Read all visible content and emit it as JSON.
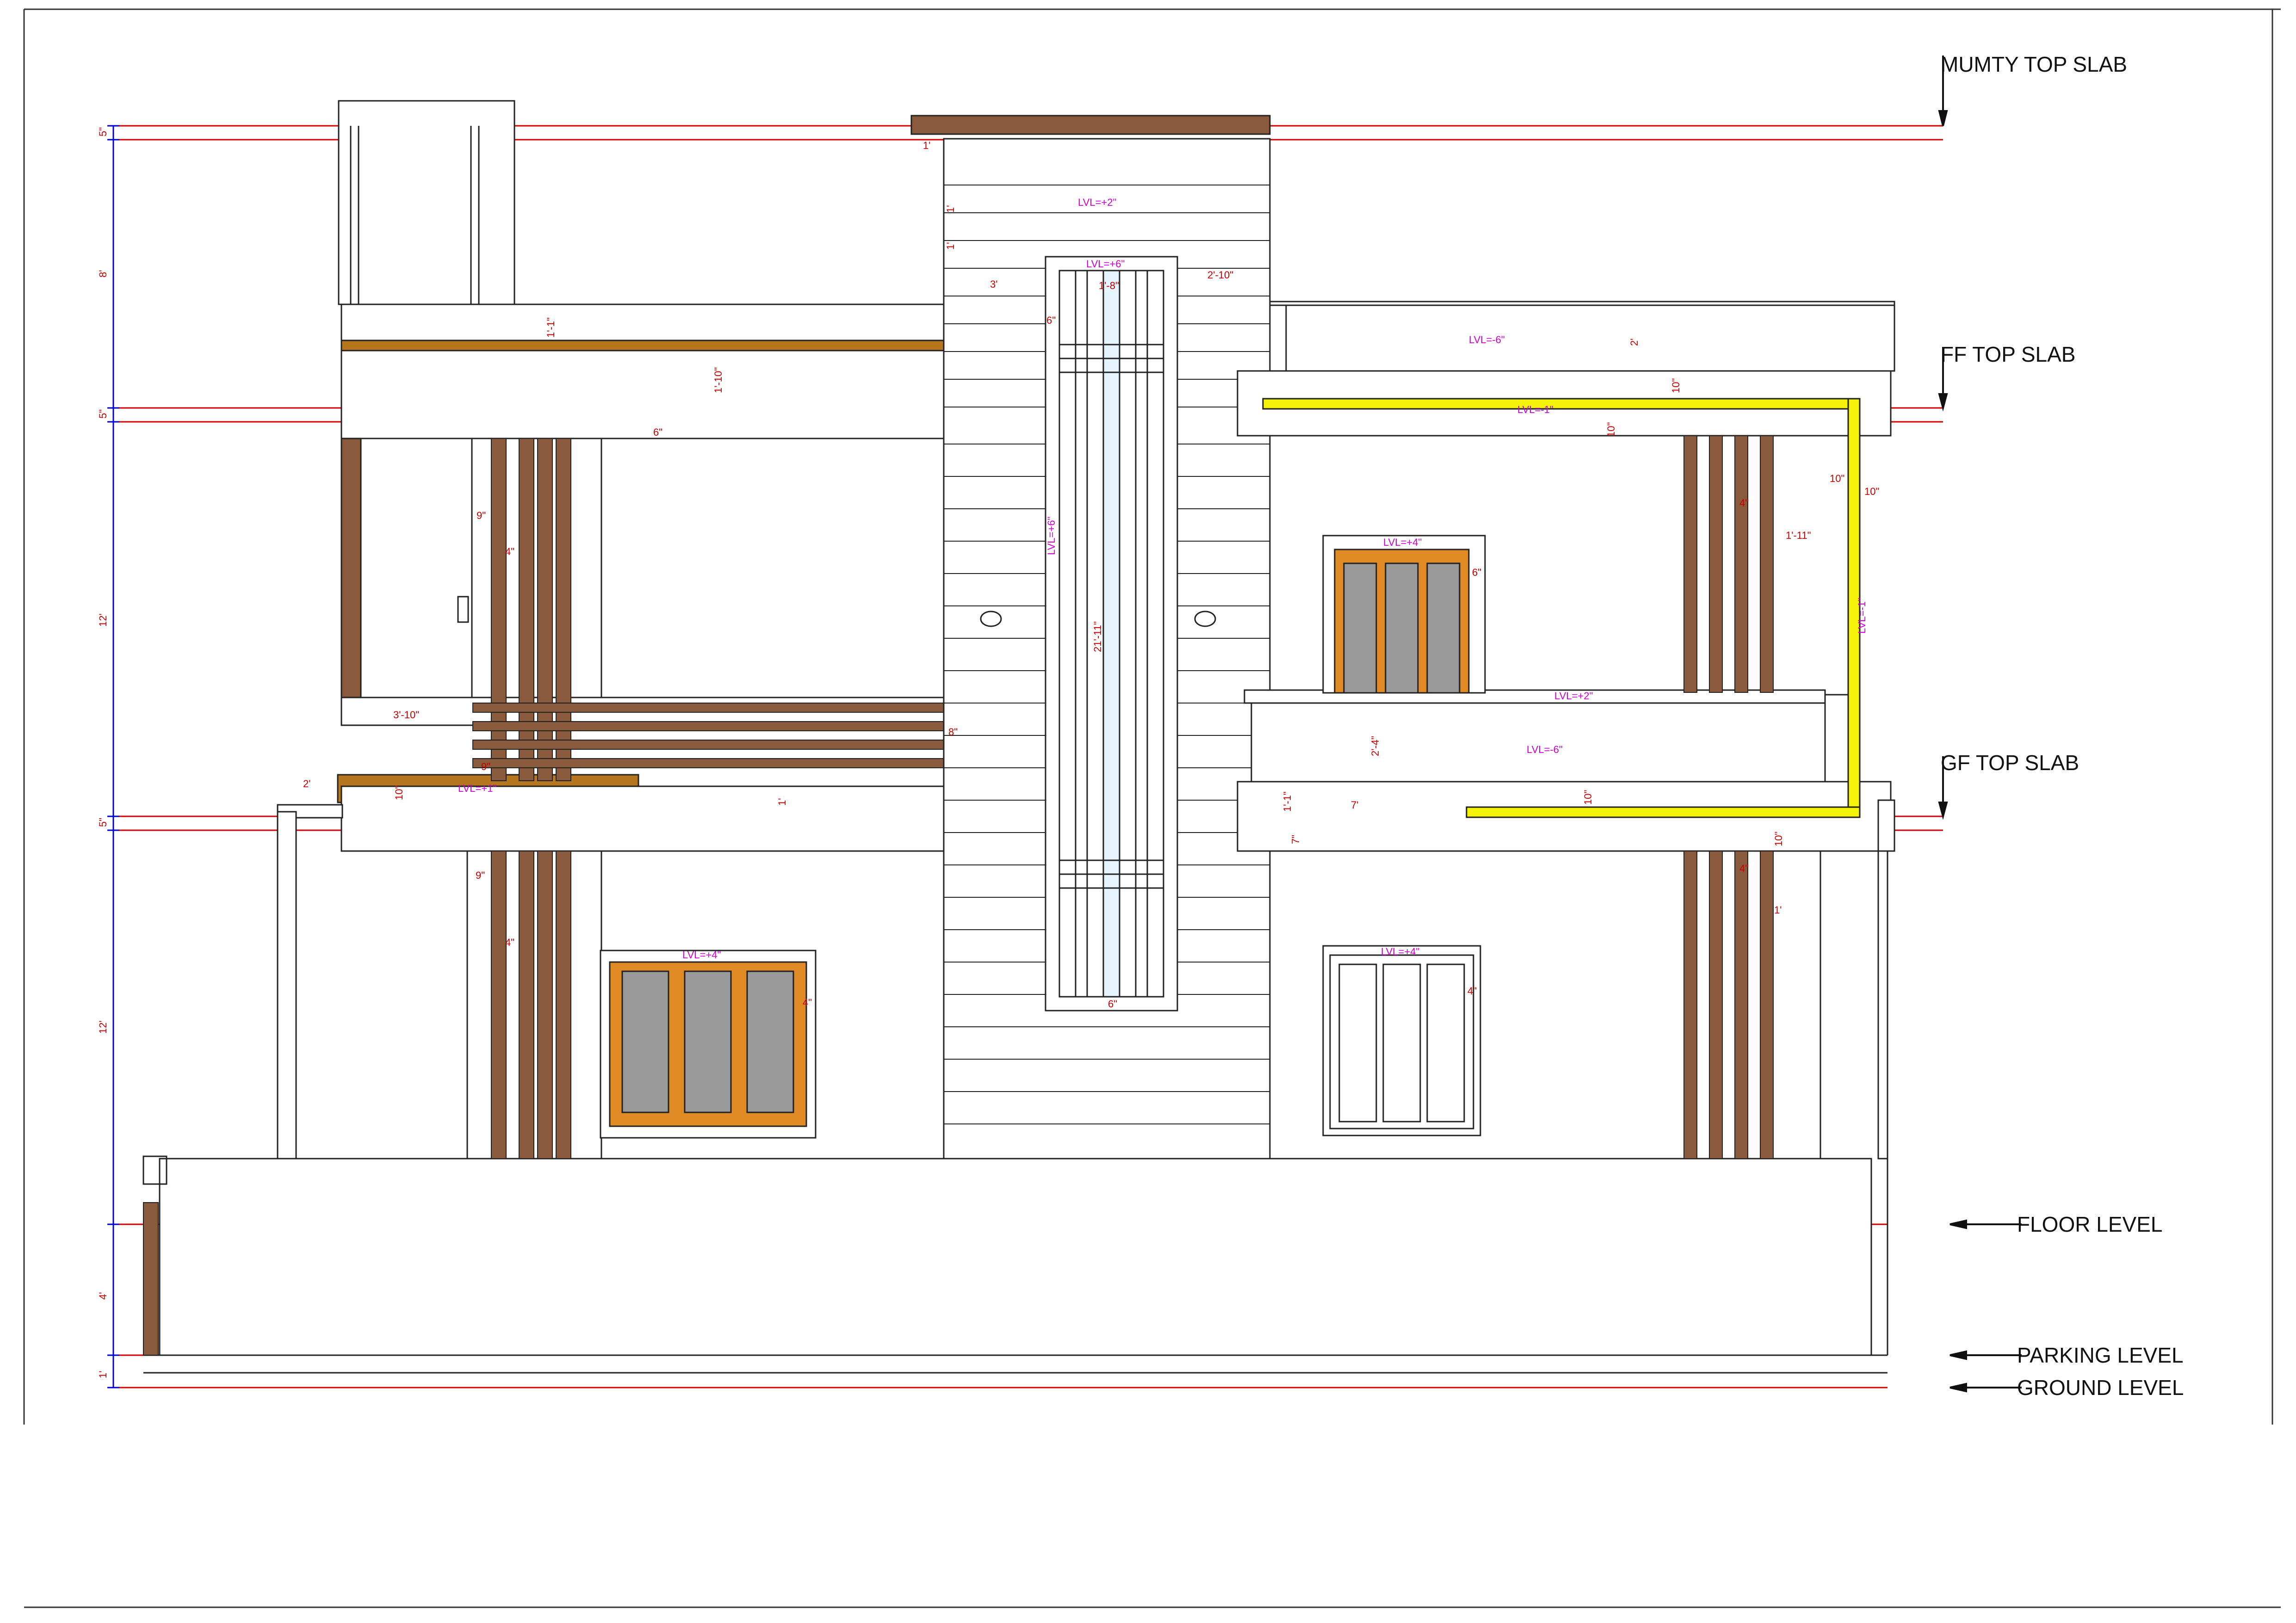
{
  "levels": {
    "mumty_top_slab": "MUMTY TOP SLAB",
    "ff_top_slab": "FF TOP SLAB",
    "gf_top_slab": "GF TOP SLAB",
    "floor_level": "FLOOR LEVEL",
    "parking_level": "PARKING LEVEL",
    "ground_level": "GROUND LEVEL"
  },
  "vertical_dims": {
    "mumty_slab": "5\"",
    "mumty_height": "8'",
    "ff_slab": "5\"",
    "ff_height": "12'",
    "gf_slab": "5\"",
    "gf_height": "12'",
    "plinth": "4'",
    "parking": "1'"
  },
  "dims": {
    "d_1ft": "1'",
    "d_3ft": "3'",
    "d_2ft10": "2'-10\"",
    "d_1ft8": "1'-8\"",
    "d_6in": "6\"",
    "d_4in": "4\"",
    "d_9in": "9\"",
    "d_3ft10": "3'-10\"",
    "d_2ft": "2'",
    "d_10in": "10\"",
    "d_8in": "8\"",
    "d_1ft1": "1'-1\"",
    "d_1ft10": "1'-10\"",
    "d_21ft11": "21'-11\"",
    "d_2ft4": "2'-4\"",
    "d_7ft": "7'",
    "d_1ft11": "1'-11\"",
    "d_7in": "7\""
  },
  "notes": {
    "lvl_p2": "LVL=+2\"",
    "lvl_p4": "LVL=+4\"",
    "lvl_p6": "LVL=+6\"",
    "lvl_m6": "LVL=-6\"",
    "lvl_p1": "LVL=+1\"",
    "lvl_m1": "LVL=-1\""
  },
  "colors": {
    "wood": "#8a5a3c",
    "slab_brown": "#b5761d",
    "frame_orange": "#e08a26",
    "yellow_band": "#f7f20a",
    "glass_grey": "#9a9a9a",
    "level_line": "#d00000",
    "dim_blue": "#0000cc",
    "note_magenta": "#d000d0"
  }
}
